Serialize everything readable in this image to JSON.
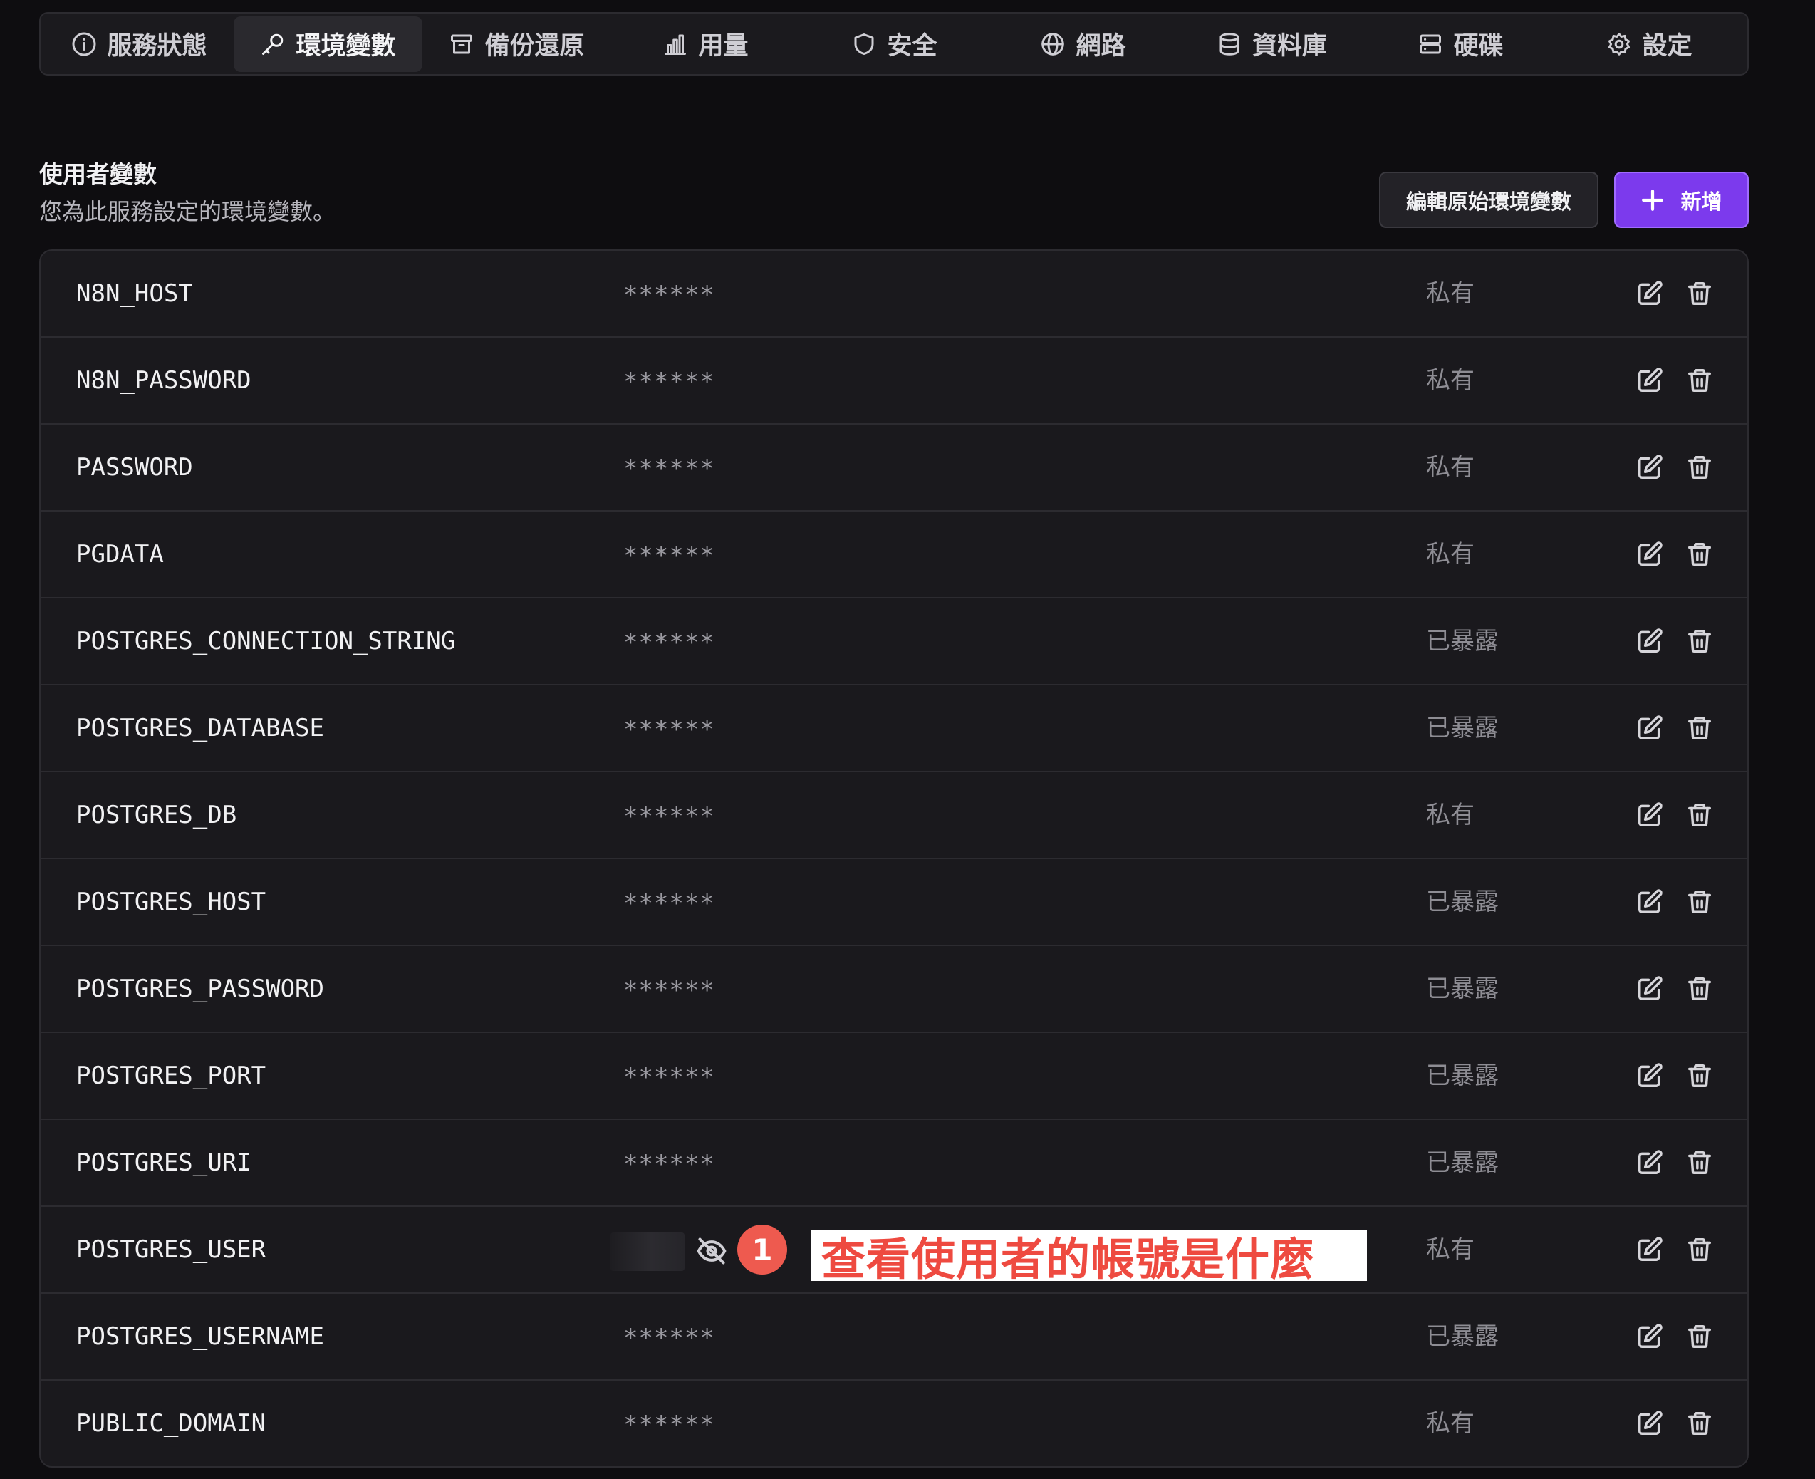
{
  "tabs": [
    {
      "label": "服務狀態",
      "icon": "info-icon",
      "active": false
    },
    {
      "label": "環境變數",
      "icon": "key-icon",
      "active": true
    },
    {
      "label": "備份還原",
      "icon": "archive-icon",
      "active": false
    },
    {
      "label": "用量",
      "icon": "bar-chart-icon",
      "active": false
    },
    {
      "label": "安全",
      "icon": "shield-icon",
      "active": false
    },
    {
      "label": "網路",
      "icon": "globe-icon",
      "active": false
    },
    {
      "label": "資料庫",
      "icon": "database-icon",
      "active": false
    },
    {
      "label": "硬碟",
      "icon": "server-icon",
      "active": false
    },
    {
      "label": "設定",
      "icon": "gear-icon",
      "active": false
    }
  ],
  "section": {
    "title": "使用者變數",
    "description": "您為此服務設定的環境變數。"
  },
  "buttons": {
    "edit_raw": "編輯原始環境變數",
    "add": "新增"
  },
  "variables": [
    {
      "name": "N8N_HOST",
      "value": "******",
      "visibility": "私有"
    },
    {
      "name": "N8N_PASSWORD",
      "value": "******",
      "visibility": "私有"
    },
    {
      "name": "PASSWORD",
      "value": "******",
      "visibility": "私有"
    },
    {
      "name": "PGDATA",
      "value": "******",
      "visibility": "私有"
    },
    {
      "name": "POSTGRES_CONNECTION_STRING",
      "value": "******",
      "visibility": "已暴露"
    },
    {
      "name": "POSTGRES_DATABASE",
      "value": "******",
      "visibility": "已暴露"
    },
    {
      "name": "POSTGRES_DB",
      "value": "******",
      "visibility": "私有"
    },
    {
      "name": "POSTGRES_HOST",
      "value": "******",
      "visibility": "已暴露"
    },
    {
      "name": "POSTGRES_PASSWORD",
      "value": "******",
      "visibility": "已暴露"
    },
    {
      "name": "POSTGRES_PORT",
      "value": "******",
      "visibility": "已暴露"
    },
    {
      "name": "POSTGRES_URI",
      "value": "******",
      "visibility": "已暴露"
    },
    {
      "name": "POSTGRES_USER",
      "value": "",
      "visibility": "私有",
      "revealed": true
    },
    {
      "name": "POSTGRES_USERNAME",
      "value": "******",
      "visibility": "已暴露"
    },
    {
      "name": "PUBLIC_DOMAIN",
      "value": "******",
      "visibility": "私有"
    }
  ],
  "annotation": {
    "step": "1",
    "text": "查看使用者的帳號是什麼",
    "color": "#ee5a4f"
  },
  "colors": {
    "accent": "#7c3aed",
    "background": "#0e0d10"
  }
}
